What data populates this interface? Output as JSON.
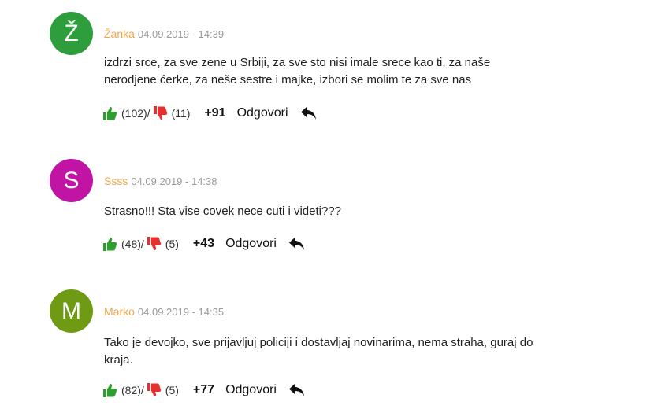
{
  "comments": [
    {
      "avatar_letter": "Ž",
      "avatar_color": "#2e9e3c",
      "author": "Žanka",
      "date": "04.09.2019 - 14:39",
      "text": "izdrzi srce, za sve zene u Srbiji, za sve sto nisi imale srece kao ti, za naše nerodjene ćerke, za neše sestre i majke, izbori se molim te za sve nas",
      "likes": "(102)/",
      "dislikes": "(11)",
      "score": "+91",
      "reply_label": "Odgovori"
    },
    {
      "avatar_letter": "S",
      "avatar_color": "#c214a4",
      "author": "Ssss",
      "date": "04.09.2019 - 14:38",
      "text": "Strasno!!! Sta vise covek nece cuti i videti???",
      "likes": "(48)/",
      "dislikes": "(5)",
      "score": "+43",
      "reply_label": "Odgovori"
    },
    {
      "avatar_letter": "M",
      "avatar_color": "#6f9b14",
      "author": "Marko",
      "date": "04.09.2019 - 14:35",
      "text": "Tako je devojko, sve prijavljuj policiji i dostavljaj novinarima, nema straha, guraj do kraja.",
      "likes": "(82)/",
      "dislikes": "(5)",
      "score": "+77",
      "reply_label": "Odgovori"
    }
  ],
  "colors": {
    "thumb_up": "#2e9e2e",
    "thumb_down": "#e53030",
    "author": "#f0a64a",
    "date": "#9a9a9a"
  },
  "icons": [
    "thumbs-up-icon",
    "thumbs-down-icon",
    "reply-arrow-icon"
  ]
}
